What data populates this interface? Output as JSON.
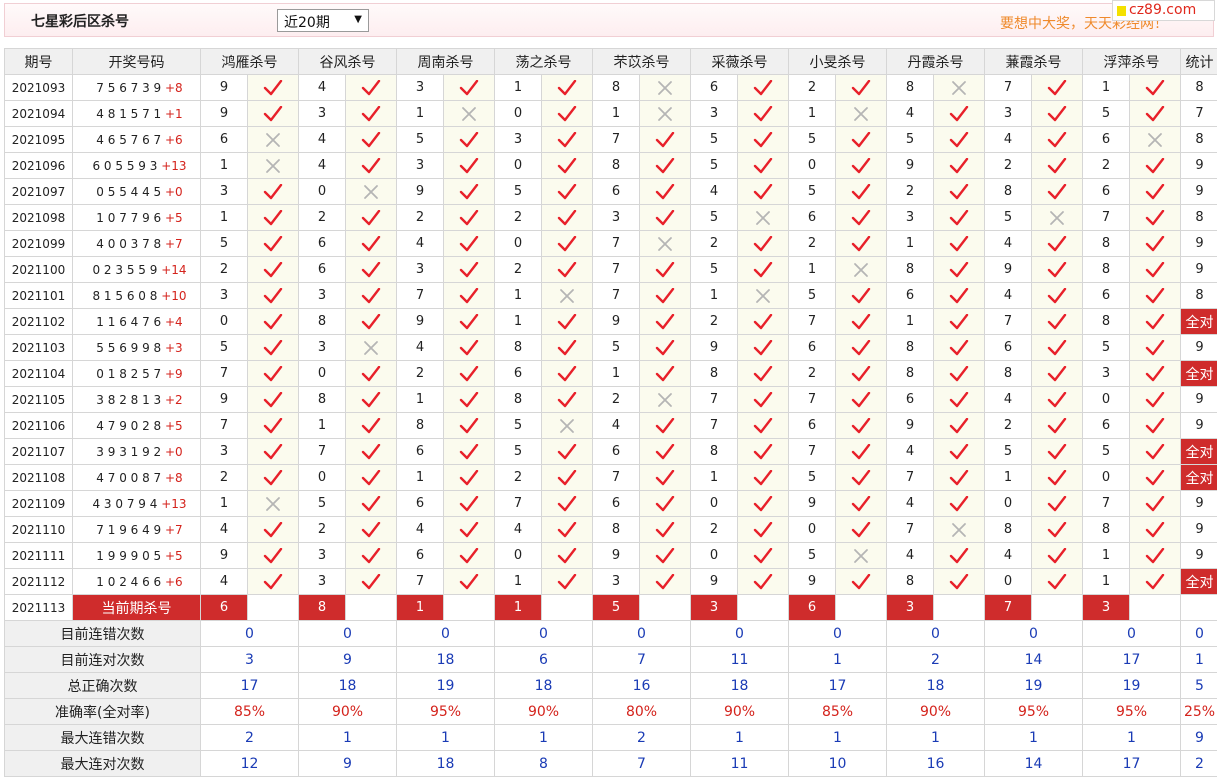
{
  "header": {
    "title": "七星彩后区杀号",
    "period_select": "近20期",
    "slogan": "要想中大奖，天天彩经网！",
    "site": "cz89.com"
  },
  "columns": {
    "issue": "期号",
    "draw": "开奖号码",
    "experts": [
      "鸿雁杀号",
      "谷风杀号",
      "周南杀号",
      "荡之杀号",
      "芣苡杀号",
      "采薇杀号",
      "小旻杀号",
      "丹霞杀号",
      "蒹霞杀号",
      "浮萍杀号"
    ],
    "stat": "统计"
  },
  "rows": [
    {
      "issue": "2021093",
      "draw": "7 5 6 7 3 9",
      "bonus": "+8",
      "picks": [
        9,
        4,
        3,
        1,
        8,
        6,
        2,
        8,
        7,
        1
      ],
      "hits": [
        1,
        1,
        1,
        1,
        0,
        1,
        1,
        0,
        1,
        1
      ],
      "stat": "8"
    },
    {
      "issue": "2021094",
      "draw": "4 8 1 5 7 1",
      "bonus": "+1",
      "picks": [
        9,
        3,
        1,
        0,
        1,
        3,
        1,
        4,
        3,
        5
      ],
      "hits": [
        1,
        1,
        0,
        1,
        0,
        1,
        0,
        1,
        1,
        1
      ],
      "stat": "7"
    },
    {
      "issue": "2021095",
      "draw": "4 6 5 7 6 7",
      "bonus": "+6",
      "picks": [
        6,
        4,
        5,
        3,
        7,
        5,
        5,
        5,
        4,
        6
      ],
      "hits": [
        0,
        1,
        1,
        1,
        1,
        1,
        1,
        1,
        1,
        0
      ],
      "stat": "8"
    },
    {
      "issue": "2021096",
      "draw": "6 0 5 5 9 3",
      "bonus": "+13",
      "picks": [
        1,
        4,
        3,
        0,
        8,
        5,
        0,
        9,
        2,
        2
      ],
      "hits": [
        0,
        1,
        1,
        1,
        1,
        1,
        1,
        1,
        1,
        1
      ],
      "stat": "9"
    },
    {
      "issue": "2021097",
      "draw": "0 5 5 4 4 5",
      "bonus": "+0",
      "picks": [
        3,
        0,
        9,
        5,
        6,
        4,
        5,
        2,
        8,
        6
      ],
      "hits": [
        1,
        0,
        1,
        1,
        1,
        1,
        1,
        1,
        1,
        1
      ],
      "stat": "9"
    },
    {
      "issue": "2021098",
      "draw": "1 0 7 7 9 6",
      "bonus": "+5",
      "picks": [
        1,
        2,
        2,
        2,
        3,
        5,
        6,
        3,
        5,
        7
      ],
      "hits": [
        1,
        1,
        1,
        1,
        1,
        0,
        1,
        1,
        0,
        1
      ],
      "stat": "8"
    },
    {
      "issue": "2021099",
      "draw": "4 0 0 3 7 8",
      "bonus": "+7",
      "picks": [
        5,
        6,
        4,
        0,
        7,
        2,
        2,
        1,
        4,
        8
      ],
      "hits": [
        1,
        1,
        1,
        1,
        0,
        1,
        1,
        1,
        1,
        1
      ],
      "stat": "9"
    },
    {
      "issue": "2021100",
      "draw": "0 2 3 5 5 9",
      "bonus": "+14",
      "picks": [
        2,
        6,
        3,
        2,
        7,
        5,
        1,
        8,
        9,
        8
      ],
      "hits": [
        1,
        1,
        1,
        1,
        1,
        1,
        0,
        1,
        1,
        1
      ],
      "stat": "9"
    },
    {
      "issue": "2021101",
      "draw": "8 1 5 6 0 8",
      "bonus": "+10",
      "picks": [
        3,
        3,
        7,
        1,
        7,
        1,
        5,
        6,
        4,
        6
      ],
      "hits": [
        1,
        1,
        1,
        0,
        1,
        0,
        1,
        1,
        1,
        1
      ],
      "stat": "8"
    },
    {
      "issue": "2021102",
      "draw": "1 1 6 4 7 6",
      "bonus": "+4",
      "picks": [
        0,
        8,
        9,
        1,
        9,
        2,
        7,
        1,
        7,
        8
      ],
      "hits": [
        1,
        1,
        1,
        1,
        1,
        1,
        1,
        1,
        1,
        1
      ],
      "stat": "全对"
    },
    {
      "issue": "2021103",
      "draw": "5 5 6 9 9 8",
      "bonus": "+3",
      "picks": [
        5,
        3,
        4,
        8,
        5,
        9,
        6,
        8,
        6,
        5
      ],
      "hits": [
        1,
        0,
        1,
        1,
        1,
        1,
        1,
        1,
        1,
        1
      ],
      "stat": "9"
    },
    {
      "issue": "2021104",
      "draw": "0 1 8 2 5 7",
      "bonus": "+9",
      "picks": [
        7,
        0,
        2,
        6,
        1,
        8,
        2,
        8,
        8,
        3
      ],
      "hits": [
        1,
        1,
        1,
        1,
        1,
        1,
        1,
        1,
        1,
        1
      ],
      "stat": "全对"
    },
    {
      "issue": "2021105",
      "draw": "3 8 2 8 1 3",
      "bonus": "+2",
      "picks": [
        9,
        8,
        1,
        8,
        2,
        7,
        7,
        6,
        4,
        0
      ],
      "hits": [
        1,
        1,
        1,
        1,
        0,
        1,
        1,
        1,
        1,
        1
      ],
      "stat": "9"
    },
    {
      "issue": "2021106",
      "draw": "4 7 9 0 2 8",
      "bonus": "+5",
      "picks": [
        7,
        1,
        8,
        5,
        4,
        7,
        6,
        9,
        2,
        6
      ],
      "hits": [
        1,
        1,
        1,
        0,
        1,
        1,
        1,
        1,
        1,
        1
      ],
      "stat": "9"
    },
    {
      "issue": "2021107",
      "draw": "3 9 3 1 9 2",
      "bonus": "+0",
      "picks": [
        3,
        7,
        6,
        5,
        6,
        8,
        7,
        4,
        5,
        5
      ],
      "hits": [
        1,
        1,
        1,
        1,
        1,
        1,
        1,
        1,
        1,
        1
      ],
      "stat": "全对"
    },
    {
      "issue": "2021108",
      "draw": "4 7 0 0 8 7",
      "bonus": "+8",
      "picks": [
        2,
        0,
        1,
        2,
        7,
        1,
        5,
        7,
        1,
        0
      ],
      "hits": [
        1,
        1,
        1,
        1,
        1,
        1,
        1,
        1,
        1,
        1
      ],
      "stat": "全对"
    },
    {
      "issue": "2021109",
      "draw": "4 3 0 7 9 4",
      "bonus": "+13",
      "picks": [
        1,
        5,
        6,
        7,
        6,
        0,
        9,
        4,
        0,
        7
      ],
      "hits": [
        0,
        1,
        1,
        1,
        1,
        1,
        1,
        1,
        1,
        1
      ],
      "stat": "9"
    },
    {
      "issue": "2021110",
      "draw": "7 1 9 6 4 9",
      "bonus": "+7",
      "picks": [
        4,
        2,
        4,
        4,
        8,
        2,
        0,
        7,
        8,
        8
      ],
      "hits": [
        1,
        1,
        1,
        1,
        1,
        1,
        1,
        0,
        1,
        1
      ],
      "stat": "9"
    },
    {
      "issue": "2021111",
      "draw": "1 9 9 9 0 5",
      "bonus": "+5",
      "picks": [
        9,
        3,
        6,
        0,
        9,
        0,
        5,
        4,
        4,
        1
      ],
      "hits": [
        1,
        1,
        1,
        1,
        1,
        1,
        0,
        1,
        1,
        1
      ],
      "stat": "9"
    },
    {
      "issue": "2021112",
      "draw": "1 0 2 4 6 6",
      "bonus": "+6",
      "picks": [
        4,
        3,
        7,
        1,
        3,
        9,
        9,
        8,
        0,
        1
      ],
      "hits": [
        1,
        1,
        1,
        1,
        1,
        1,
        1,
        1,
        1,
        1
      ],
      "stat": "全对"
    }
  ],
  "current": {
    "issue": "2021113",
    "label": "当前期杀号",
    "picks": [
      6,
      8,
      1,
      1,
      5,
      3,
      6,
      3,
      7,
      3
    ]
  },
  "summary": [
    {
      "label": "目前连错次数",
      "values": [
        "0",
        "0",
        "0",
        "0",
        "0",
        "0",
        "0",
        "0",
        "0",
        "0",
        "0"
      ]
    },
    {
      "label": "目前连对次数",
      "values": [
        "3",
        "9",
        "18",
        "6",
        "7",
        "11",
        "1",
        "2",
        "14",
        "17",
        "1"
      ]
    },
    {
      "label": "总正确次数",
      "values": [
        "17",
        "18",
        "19",
        "18",
        "16",
        "18",
        "17",
        "18",
        "19",
        "19",
        "5"
      ]
    },
    {
      "label": "准确率(全对率)",
      "values": [
        "85%",
        "90%",
        "95%",
        "90%",
        "80%",
        "90%",
        "85%",
        "90%",
        "95%",
        "95%",
        "25%"
      ],
      "pct": true
    },
    {
      "label": "最大连错次数",
      "values": [
        "2",
        "1",
        "1",
        "1",
        "2",
        "1",
        "1",
        "1",
        "1",
        "1",
        "9"
      ]
    },
    {
      "label": "最大连对次数",
      "values": [
        "12",
        "9",
        "18",
        "8",
        "7",
        "11",
        "10",
        "16",
        "14",
        "17",
        "2"
      ]
    }
  ],
  "colors": {
    "accent": "#cf2c2c",
    "hit": "#e8202a",
    "miss": "#b5b5b5",
    "value": "#1a3bb5"
  },
  "icons": {
    "hit": "check-icon",
    "miss": "cross-icon"
  }
}
